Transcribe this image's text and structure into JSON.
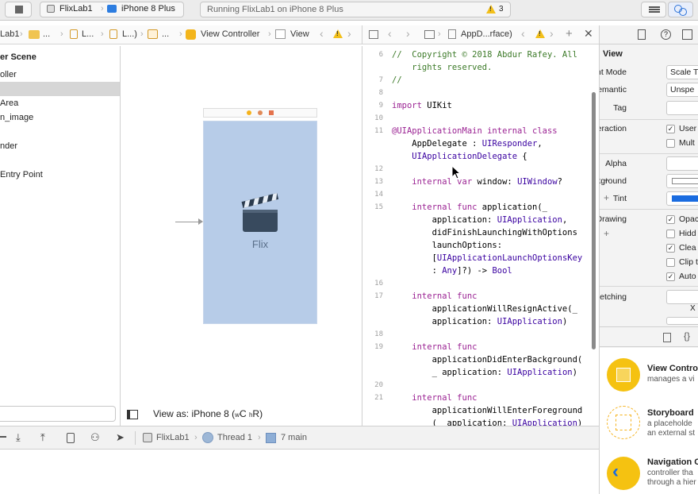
{
  "toolbar": {
    "scheme": "FlixLab1",
    "device": "iPhone 8 Plus",
    "status": "Running FlixLab1 on iPhone 8 Plus",
    "warning_count": "3"
  },
  "storyboard_jumpbar": {
    "items": [
      "Lab1",
      "...",
      "L...",
      "L...)",
      "...",
      "View Controller",
      "View"
    ]
  },
  "code_jumpbar": {
    "file": "AppD...rface)"
  },
  "outline": {
    "rows": [
      "er Scene",
      "oller",
      "",
      "Area",
      "n_image",
      "nder",
      "Entry Point"
    ]
  },
  "canvas": {
    "app_name": "Flix",
    "view_as": "View as: iPhone 8 (",
    "view_as_w": "w",
    "view_as_c": "C ",
    "view_as_h": "h",
    "view_as_r": "R)"
  },
  "code": {
    "lines": [
      {
        "n": "6",
        "parts": [
          {
            "t": "//  Copyright © 2018 Abdur Rafey. All",
            "c": "cm"
          }
        ]
      },
      {
        "n": "",
        "parts": [
          {
            "t": "    rights reserved.",
            "c": "cm"
          }
        ]
      },
      {
        "n": "7",
        "parts": [
          {
            "t": "//",
            "c": "cm"
          }
        ]
      },
      {
        "n": "8",
        "parts": []
      },
      {
        "n": "9",
        "parts": [
          {
            "t": "import",
            "c": "kw"
          },
          {
            "t": " UIKit",
            "c": ""
          }
        ]
      },
      {
        "n": "10",
        "parts": []
      },
      {
        "n": "11",
        "parts": [
          {
            "t": "@UIApplicationMain internal class",
            "c": "kw"
          }
        ]
      },
      {
        "n": "",
        "parts": [
          {
            "t": "    AppDelegate : ",
            "c": ""
          },
          {
            "t": "UIResponder",
            "c": "ty"
          },
          {
            "t": ",",
            "c": ""
          }
        ]
      },
      {
        "n": "",
        "parts": [
          {
            "t": "    ",
            "c": ""
          },
          {
            "t": "UIApplicationDelegate",
            "c": "ty"
          },
          {
            "t": " {",
            "c": ""
          }
        ]
      },
      {
        "n": "12",
        "parts": []
      },
      {
        "n": "13",
        "parts": [
          {
            "t": "    internal var",
            "c": "kw"
          },
          {
            "t": " window: ",
            "c": ""
          },
          {
            "t": "UIWindow",
            "c": "ty"
          },
          {
            "t": "?",
            "c": ""
          }
        ]
      },
      {
        "n": "14",
        "parts": []
      },
      {
        "n": "15",
        "parts": [
          {
            "t": "    internal func",
            "c": "kw"
          },
          {
            "t": " application(_",
            "c": ""
          }
        ]
      },
      {
        "n": "",
        "parts": [
          {
            "t": "        application: ",
            "c": ""
          },
          {
            "t": "UIApplication",
            "c": "ty"
          },
          {
            "t": ",",
            "c": ""
          }
        ]
      },
      {
        "n": "",
        "parts": [
          {
            "t": "        didFinishLaunchingWithOptions",
            "c": ""
          }
        ]
      },
      {
        "n": "",
        "parts": [
          {
            "t": "        launchOptions:",
            "c": ""
          }
        ]
      },
      {
        "n": "",
        "parts": [
          {
            "t": "        [",
            "c": ""
          },
          {
            "t": "UIApplicationLaunchOptionsKey",
            "c": "ty"
          }
        ]
      },
      {
        "n": "",
        "parts": [
          {
            "t": "        : ",
            "c": ""
          },
          {
            "t": "Any",
            "c": "ty"
          },
          {
            "t": "]?) -> ",
            "c": ""
          },
          {
            "t": "Bool",
            "c": "ty"
          }
        ]
      },
      {
        "n": "16",
        "parts": []
      },
      {
        "n": "17",
        "parts": [
          {
            "t": "    internal func",
            "c": "kw"
          }
        ]
      },
      {
        "n": "",
        "parts": [
          {
            "t": "        applicationWillResignActive(_",
            "c": ""
          }
        ]
      },
      {
        "n": "",
        "parts": [
          {
            "t": "        application: ",
            "c": ""
          },
          {
            "t": "UIApplication",
            "c": "ty"
          },
          {
            "t": ")",
            "c": ""
          }
        ]
      },
      {
        "n": "18",
        "parts": []
      },
      {
        "n": "19",
        "parts": [
          {
            "t": "    internal func",
            "c": "kw"
          }
        ]
      },
      {
        "n": "",
        "parts": [
          {
            "t": "        applicationDidEnterBackground(",
            "c": ""
          }
        ]
      },
      {
        "n": "",
        "parts": [
          {
            "t": "        _ application: ",
            "c": ""
          },
          {
            "t": "UIApplication",
            "c": "ty"
          },
          {
            "t": ")",
            "c": ""
          }
        ]
      },
      {
        "n": "20",
        "parts": []
      },
      {
        "n": "21",
        "parts": [
          {
            "t": "    internal func",
            "c": "kw"
          }
        ]
      },
      {
        "n": "",
        "parts": [
          {
            "t": "        applicationWillEnterForeground",
            "c": ""
          }
        ]
      },
      {
        "n": "",
        "parts": [
          {
            "t": "        (_ application: ",
            "c": ""
          },
          {
            "t": "UIApplication",
            "c": "ty"
          },
          {
            "t": ")",
            "c": ""
          }
        ]
      }
    ]
  },
  "inspector": {
    "section": "View",
    "content_mode_label": "Content Mode",
    "content_mode_value": "Scale T",
    "semantic_label": "Semantic",
    "semantic_value": "Unspe",
    "tag_label": "Tag",
    "interaction_label": "Interaction",
    "user_label": "User",
    "multi_label": "Mult",
    "alpha_label": "Alpha",
    "background_label": "Background",
    "tint_label": "Tint",
    "drawing_label": "Drawing",
    "opaque_label": "Opac",
    "hidden_label": "Hidd",
    "clears_label": "Clea",
    "clip_label": "Clip t",
    "autoresize_label": "Auto",
    "stretching_label": "Stretching",
    "x_label": "X",
    "plus": "+"
  },
  "library": {
    "items": [
      {
        "title": "View Contro",
        "desc1": "manages a vi",
        "desc2": ""
      },
      {
        "title": "Storyboard",
        "desc1": "a placeholde",
        "desc2": "an external st"
      },
      {
        "title": "Navigation C",
        "desc1": "controller tha",
        "desc2": "through a hier"
      }
    ]
  },
  "debug": {
    "app": "FlixLab1",
    "thread": "Thread 1",
    "frame": "7 main"
  },
  "colors": {
    "tint": "#1a6ce0",
    "warning": "#f3c01a",
    "library_icon": "#f5c211",
    "phone_bg": "#b7cce8"
  }
}
